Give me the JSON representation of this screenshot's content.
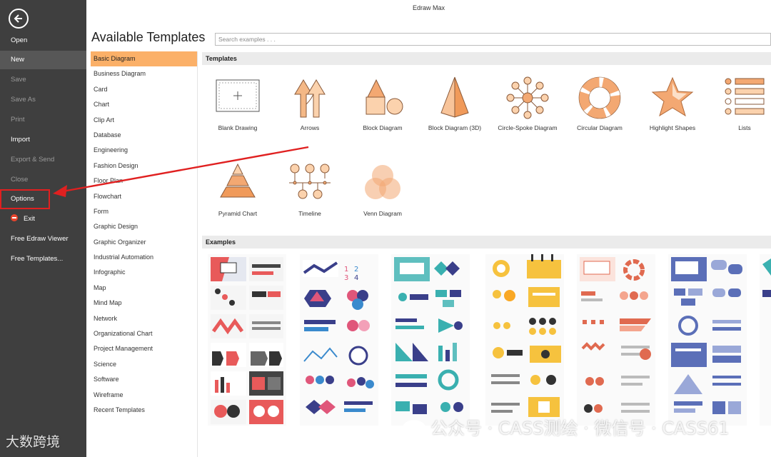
{
  "window": {
    "title": "Edraw Max"
  },
  "sidebar": {
    "items": [
      {
        "label": "Open",
        "state": "normal"
      },
      {
        "label": "New",
        "state": "active"
      },
      {
        "label": "Save",
        "state": "dim"
      },
      {
        "label": "Save As",
        "state": "dim"
      },
      {
        "label": "Print",
        "state": "dim"
      },
      {
        "label": "Import",
        "state": "normal"
      },
      {
        "label": "Export & Send",
        "state": "dim"
      },
      {
        "label": "Close",
        "state": "dim"
      },
      {
        "label": "Options",
        "state": "highlighted"
      },
      {
        "label": "Exit",
        "state": "normal"
      },
      {
        "label": "Free Edraw Viewer",
        "state": "normal"
      },
      {
        "label": "Free Templates...",
        "state": "normal"
      }
    ]
  },
  "main": {
    "heading": "Available Templates",
    "search_placeholder": "Search examples . . .",
    "templates_header": "Templates",
    "examples_header": "Examples",
    "categories": [
      "Basic Diagram",
      "Business Diagram",
      "Card",
      "Chart",
      "Clip Art",
      "Database",
      "Engineering",
      "Fashion Design",
      "Floor Plan",
      "Flowchart",
      "Form",
      "Graphic Design",
      "Graphic Organizer",
      "Industrial Automation",
      "Infographic",
      "Map",
      "Mind Map",
      "Network",
      "Organizational Chart",
      "Project Management",
      "Science",
      "Software",
      "Wireframe",
      "Recent Templates"
    ],
    "selected_category": "Basic Diagram",
    "templates": [
      {
        "label": "Blank Drawing",
        "icon": "blank-drawing-icon"
      },
      {
        "label": "Arrows",
        "icon": "arrows-icon"
      },
      {
        "label": "Block Diagram",
        "icon": "block-diagram-icon"
      },
      {
        "label": "Block Diagram (3D)",
        "icon": "block-diagram-3d-icon"
      },
      {
        "label": "Circle-Spoke Diagram",
        "icon": "circle-spoke-icon"
      },
      {
        "label": "Circular Diagram",
        "icon": "circular-diagram-icon"
      },
      {
        "label": "Highlight Shapes",
        "icon": "star-icon"
      },
      {
        "label": "Lists",
        "icon": "lists-icon"
      },
      {
        "label": "Pyramid Chart",
        "icon": "pyramid-icon"
      },
      {
        "label": "Timeline",
        "icon": "timeline-icon"
      },
      {
        "label": "Venn Diagram",
        "icon": "venn-icon"
      }
    ]
  },
  "colors": {
    "sidebar_bg": "#3f3f3f",
    "accent_orange": "#fbb068",
    "template_orange": "#f3a872",
    "highlight_red": "#e02020"
  },
  "watermark": {
    "left": "大数跨境",
    "right": "公众号 · CASS测绘 · 微信号 · CASS61"
  }
}
